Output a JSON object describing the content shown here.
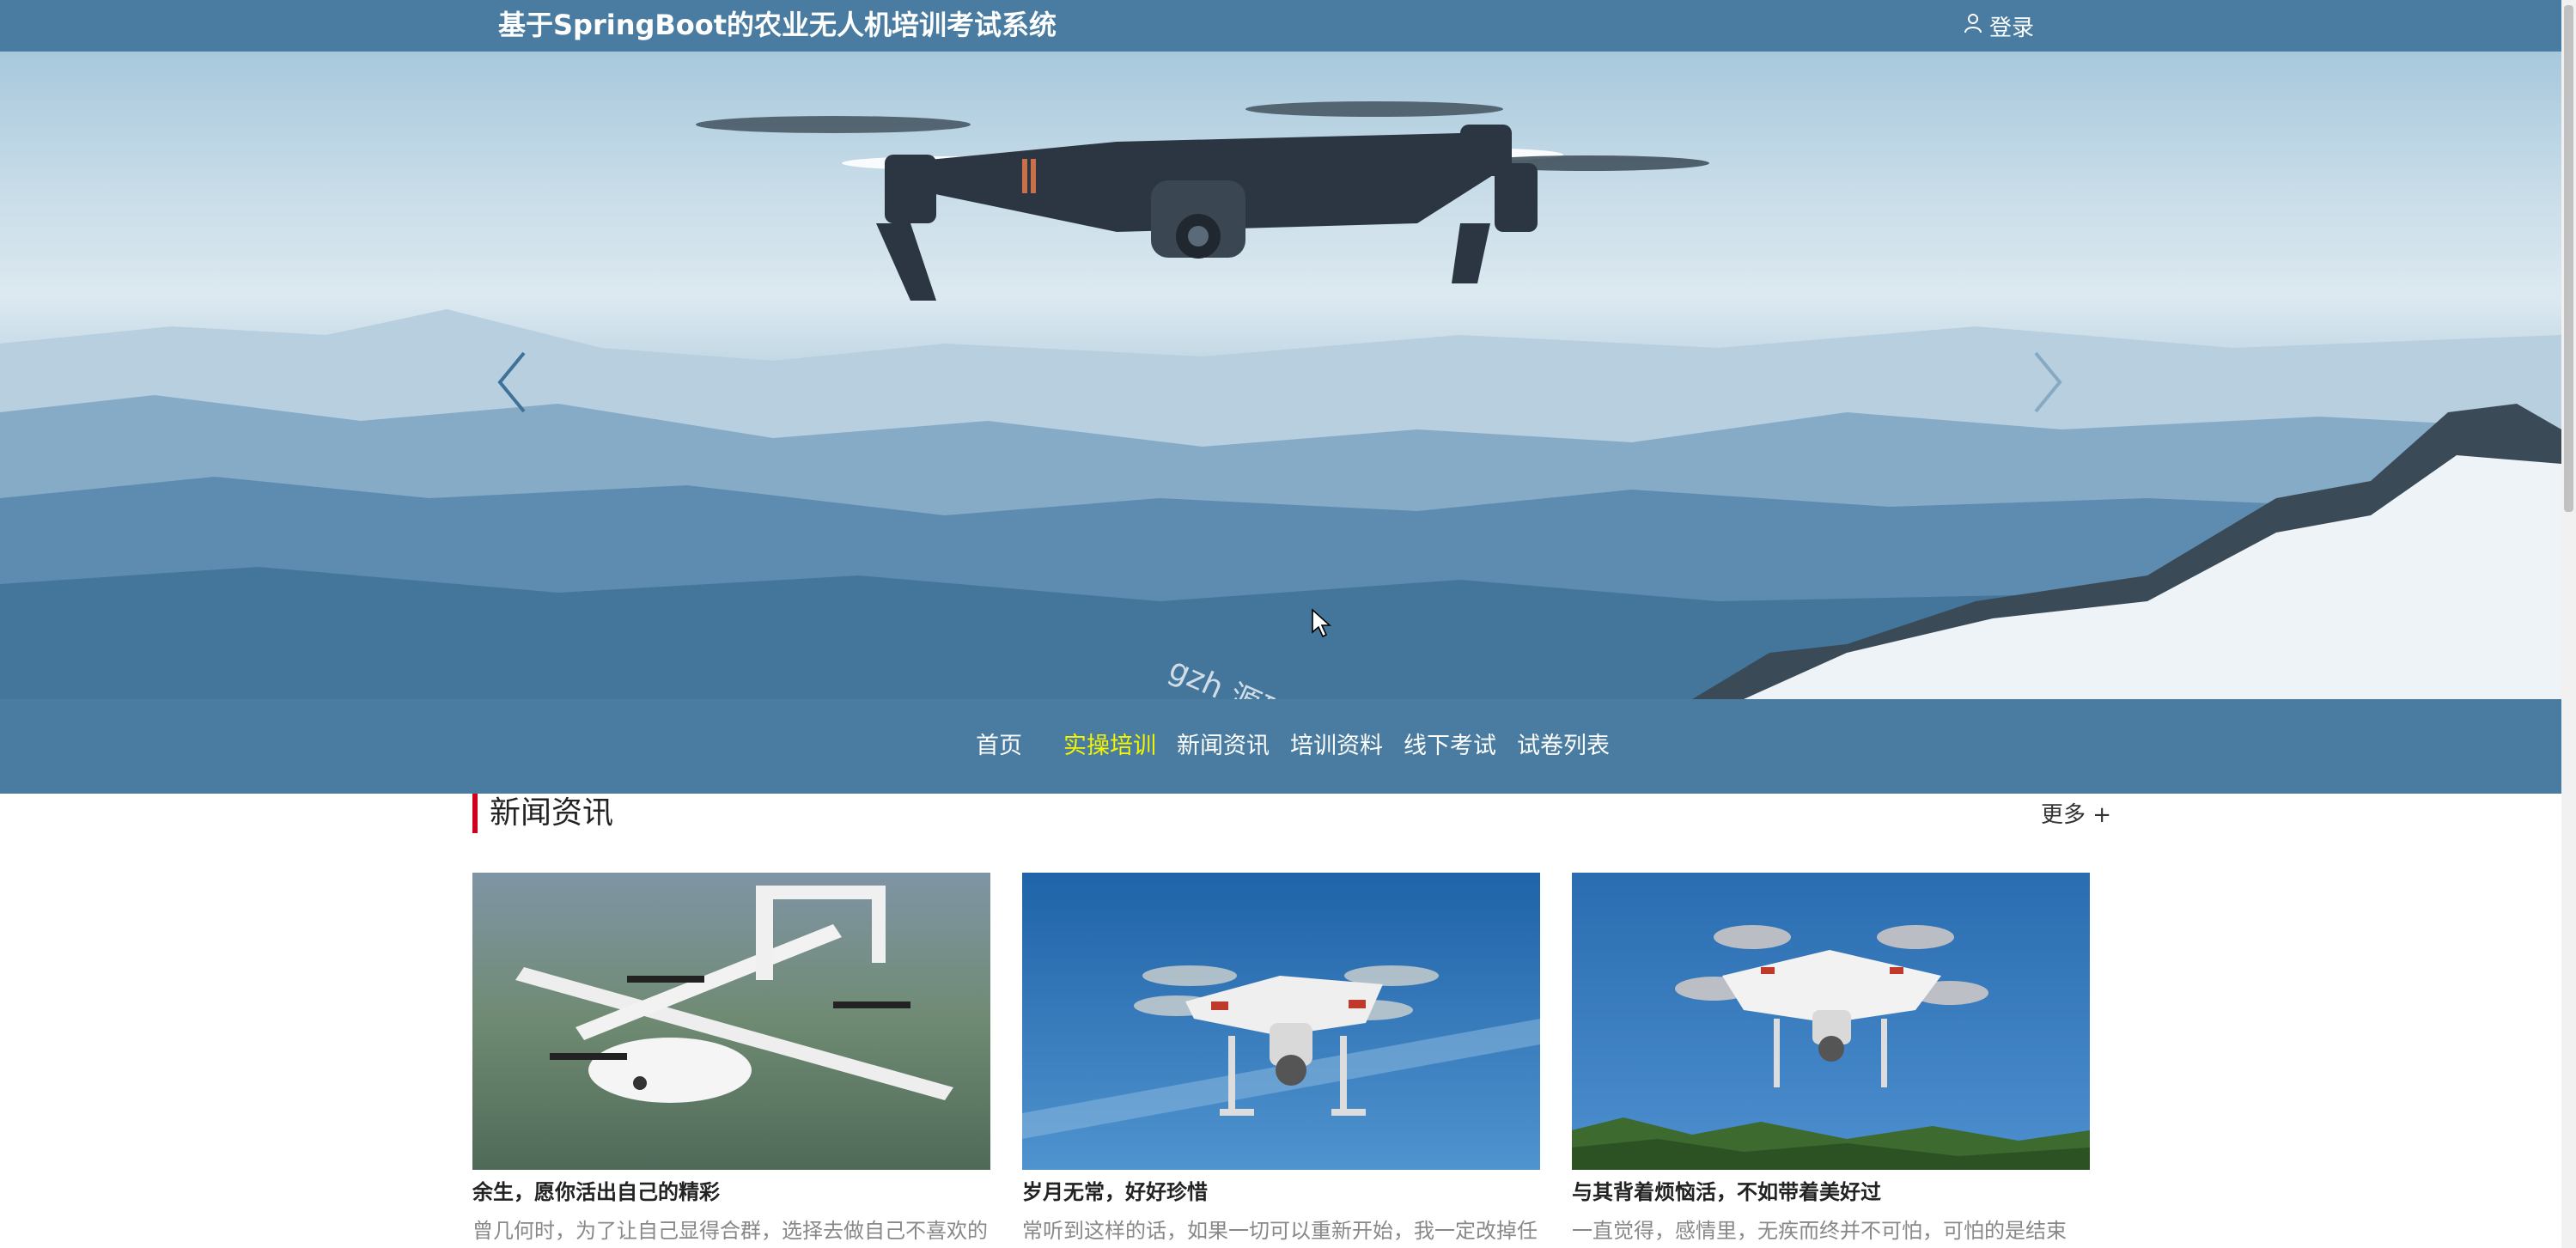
{
  "header": {
    "site_title": "基于SpringBoot的农业无人机培训考试系统",
    "login_label": "登录"
  },
  "hero": {
    "watermark": "gzh 源码好优多",
    "prev_icon": "chevron-left-icon",
    "next_icon": "chevron-right-icon"
  },
  "nav": {
    "items": [
      {
        "label": "首页",
        "active": false
      },
      {
        "label": "实操培训",
        "active": true
      },
      {
        "label": "新闻资讯",
        "active": false
      },
      {
        "label": "培训资料",
        "active": false
      },
      {
        "label": "线下考试",
        "active": false
      },
      {
        "label": "试卷列表",
        "active": false
      }
    ]
  },
  "news": {
    "section_title": "新闻资讯",
    "more_label": "更多 +",
    "cards": [
      {
        "title": "余生，愿你活出自己的精彩",
        "excerpt": "曾几何时，为了让自己显得合群，选择去做自己不喜欢的"
      },
      {
        "title": "岁月无常，好好珍惜",
        "excerpt": "常听到这样的话，如果一切可以重新开始，我一定改掉任"
      },
      {
        "title": "与其背着烦恼活，不如带着美好过",
        "excerpt": "一直觉得，感情里，无疾而终并不可怕，可怕的是结束"
      }
    ]
  },
  "colors": {
    "primary": "#497ca0",
    "active_nav": "#f5f500",
    "section_accent": "#d0021b"
  }
}
